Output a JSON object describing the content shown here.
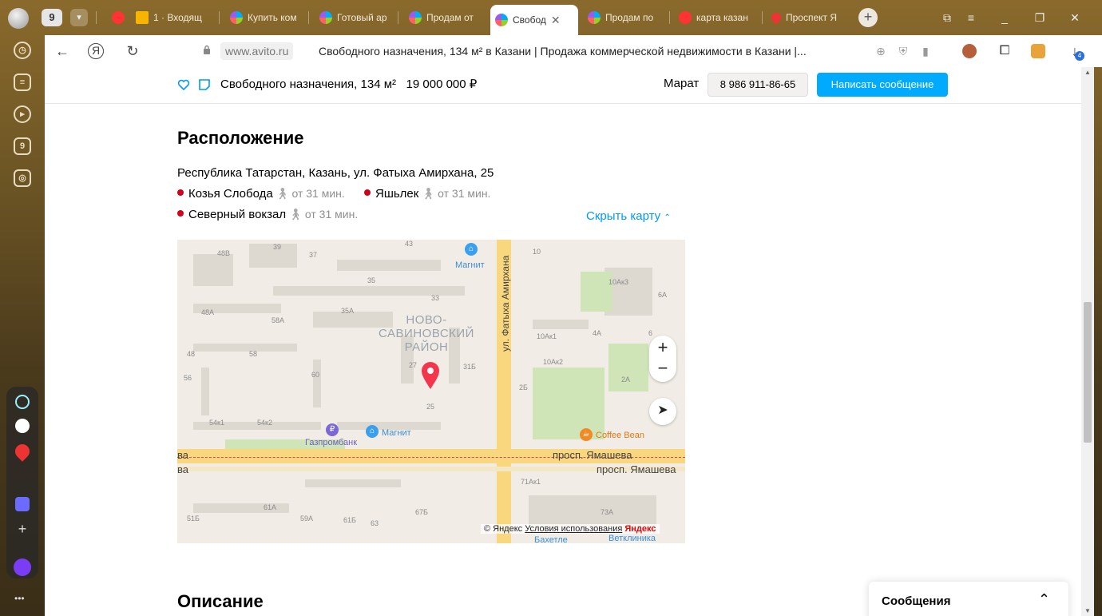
{
  "browser": {
    "tab_count": "9",
    "tabs": [
      {
        "label": "1 · Входящ",
        "favicon": "mail-icon"
      },
      {
        "label": "Купить ком",
        "favicon": "avito-icon"
      },
      {
        "label": "Готовый ар",
        "favicon": "avito-icon"
      },
      {
        "label": "Продам от",
        "favicon": "avito-icon"
      },
      {
        "label": "Свобод",
        "favicon": "avito-icon",
        "active": true
      },
      {
        "label": "Продам по",
        "favicon": "avito-icon"
      },
      {
        "label": "карта казан",
        "favicon": "yandex-icon"
      },
      {
        "label": "Проспект Я",
        "favicon": "maps-pin-icon"
      }
    ],
    "url_domain": "www.avito.ru",
    "page_title": "Свободного назначения, 134 м² в Казани | Продажа коммерческой недвижимости в Казани |...",
    "downloads_badge": "4"
  },
  "sticky": {
    "title": "Свободного назначения, 134 м²",
    "price": "19 000 000 ₽",
    "seller": "Марат",
    "phone": "8 986 911-86-65",
    "message_button": "Написать сообщение"
  },
  "location": {
    "heading": "Расположение",
    "address": "Республика Татарстан, Казань, ул. Фатыха Амирхана, 25",
    "metro": [
      {
        "name": "Козья Слобода",
        "time": "от 31 мин.",
        "color": "#d0021b"
      },
      {
        "name": "Яшьлек",
        "time": "от 31 мин.",
        "color": "#d0021b"
      },
      {
        "name": "Северный вокзал",
        "time": "от 31 мин.",
        "color": "#d0021b"
      }
    ],
    "hide_map": "Скрыть карту"
  },
  "map": {
    "district": "НОВО-\nСАВИНОВСКИЙ\nРАЙОН",
    "street_vertical": "ул. Фатыха Амирхана",
    "street_horizontal_1": "просп. Ямашева",
    "street_horizontal_2": "просп. Ямашева",
    "street_left_1": "ва",
    "street_left_2": "ва",
    "pois": {
      "magnit_top": "Магнит",
      "magnit_bottom": "Магнит",
      "gazprombank": "Газпромбанк",
      "coffee_bean": "Coffee Bean",
      "bahetle": "Бахетле",
      "vetclinic": "Ветклиника"
    },
    "house_numbers": [
      "48В",
      "39",
      "37",
      "43",
      "10",
      "35",
      "10Ак3",
      "6А",
      "33",
      "48А",
      "58А",
      "35А",
      "10Ак1",
      "4А",
      "6",
      "48",
      "58",
      "27",
      "31Б",
      "10Ак2",
      "56",
      "60",
      "25",
      "2Б",
      "2А",
      "54к1",
      "54к2",
      "71Ак1",
      "61А",
      "67Б",
      "73А",
      "51Б",
      "59А",
      "61Б",
      "63"
    ],
    "attribution": "© Яндекс",
    "terms": "Условия использования",
    "logo": "Яндекс",
    "zoom_in": "+",
    "zoom_out": "−"
  },
  "description": {
    "heading": "Описание"
  },
  "messages": {
    "label": "Сообщения"
  },
  "colors": {
    "accent": "#00aaff",
    "link": "#0099f7",
    "metro_red": "#d0021b",
    "road": "#f9d77e"
  }
}
